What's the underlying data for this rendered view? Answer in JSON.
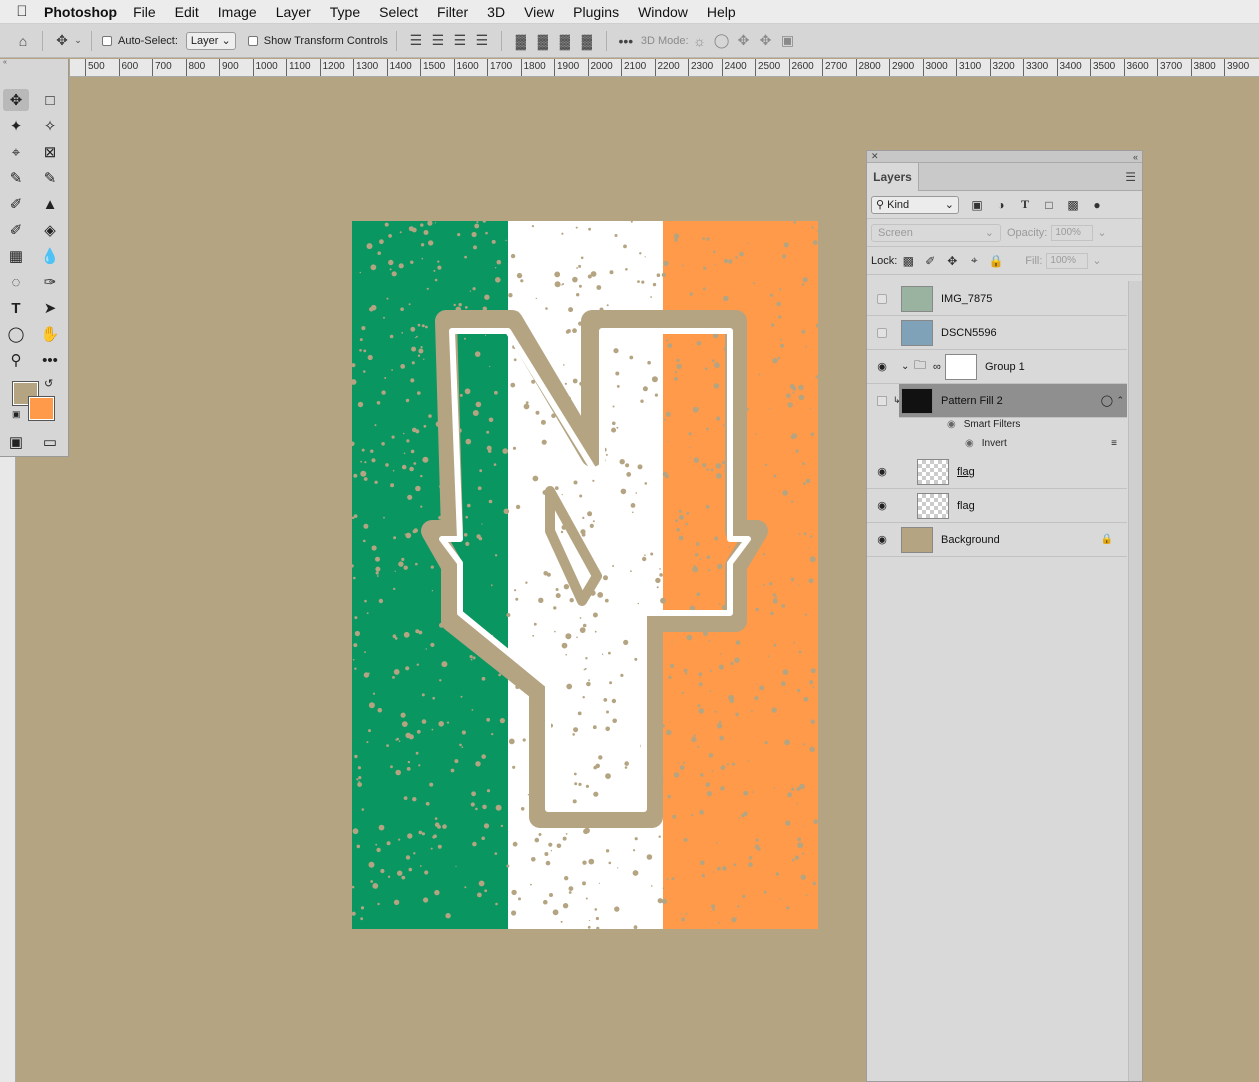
{
  "menubar": {
    "app_name": "Photoshop",
    "items": [
      "File",
      "Edit",
      "Image",
      "Layer",
      "Type",
      "Select",
      "Filter",
      "3D",
      "View",
      "Plugins",
      "Window",
      "Help"
    ]
  },
  "options": {
    "auto_select_label": "Auto-Select:",
    "auto_select_value": "Layer",
    "transform_label": "Show Transform Controls",
    "mode_3d_label": "3D Mode:"
  },
  "ruler": {
    "ticks": [
      "500",
      "600",
      "700",
      "800",
      "900",
      "1000",
      "1100",
      "1200",
      "1300",
      "1400",
      "1500",
      "1600",
      "1700",
      "1800",
      "1900",
      "2000",
      "2100",
      "2200",
      "2300",
      "2400",
      "2500",
      "2600",
      "2700",
      "2800",
      "2900",
      "3000",
      "3100",
      "3200",
      "3300",
      "3400",
      "3500",
      "3600",
      "3700",
      "3800",
      "3900"
    ]
  },
  "colors": {
    "canvas_bg": "#b4a482",
    "green": "#099661",
    "orange": "#fe9a49",
    "white": "#ffffff",
    "foreground": "#b4a482",
    "background": "#fe9a49"
  },
  "layers_panel": {
    "tab": "Layers",
    "kind": "Kind",
    "blend_mode": "Screen",
    "opacity_label": "Opacity:",
    "opacity_value": "100%",
    "lock_label": "Lock:",
    "fill_label": "Fill:",
    "fill_value": "100%",
    "layers": [
      {
        "name": "IMG_7875",
        "visible": false
      },
      {
        "name": "DSCN5596",
        "visible": false
      },
      {
        "name": "Group 1",
        "visible": true
      },
      {
        "name": "Pattern Fill 2",
        "visible": false
      },
      {
        "name": "flag",
        "visible": true
      },
      {
        "name": "flag",
        "visible": true
      },
      {
        "name": "Background",
        "visible": true
      }
    ],
    "smart_filters": "Smart Filters",
    "invert": "Invert"
  }
}
